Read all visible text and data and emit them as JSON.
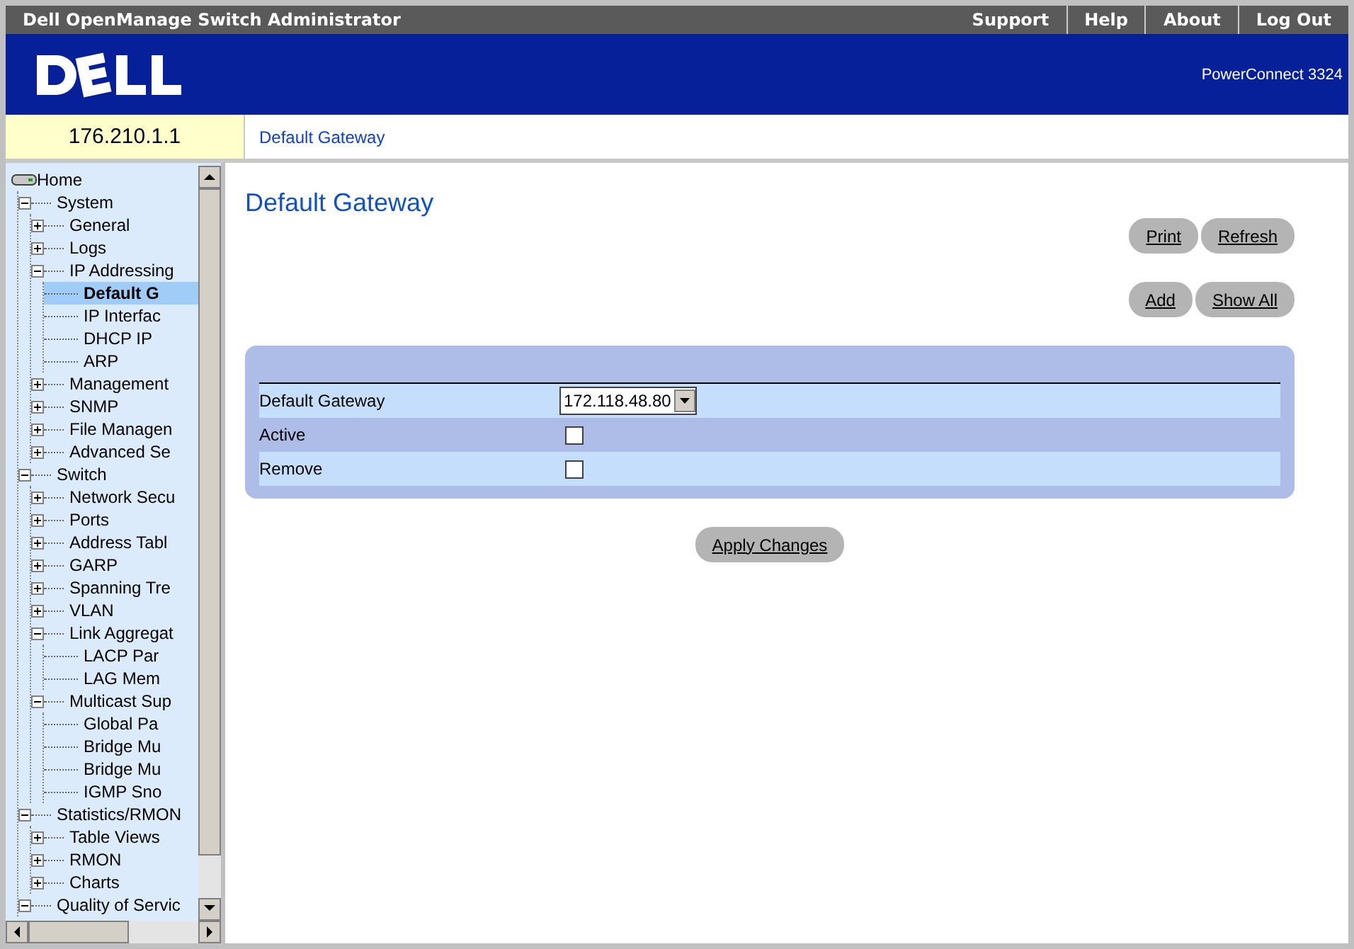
{
  "window": {
    "title": "Dell OpenManage Switch Administrator"
  },
  "top_links": [
    "Support",
    "Help",
    "About",
    "Log Out"
  ],
  "banner": {
    "model": "PowerConnect 3324"
  },
  "device_ip": "176.210.1.1",
  "breadcrumb": "Default Gateway",
  "tree": [
    {
      "label": "Home",
      "kind": "root",
      "children": [
        {
          "label": "System",
          "kind": "folder",
          "expanded": true,
          "children": [
            {
              "label": "General",
              "kind": "folder",
              "expanded": false
            },
            {
              "label": "Logs",
              "kind": "folder",
              "expanded": false
            },
            {
              "label": "IP Addressing",
              "kind": "folder",
              "expanded": true,
              "children": [
                {
                  "label": "Default G",
                  "kind": "leaf",
                  "selected": true
                },
                {
                  "label": "IP Interfac",
                  "kind": "leaf",
                  "selected": false
                },
                {
                  "label": "DHCP IP",
                  "kind": "leaf",
                  "selected": false
                },
                {
                  "label": "ARP",
                  "kind": "leaf",
                  "selected": false
                }
              ]
            },
            {
              "label": "Management",
              "kind": "folder",
              "expanded": false
            },
            {
              "label": "SNMP",
              "kind": "folder",
              "expanded": false
            },
            {
              "label": "File Managen",
              "kind": "folder",
              "expanded": false
            },
            {
              "label": "Advanced Se",
              "kind": "folder",
              "expanded": false
            }
          ]
        },
        {
          "label": "Switch",
          "kind": "folder",
          "expanded": true,
          "children": [
            {
              "label": "Network Secu",
              "kind": "folder",
              "expanded": false
            },
            {
              "label": "Ports",
              "kind": "folder",
              "expanded": false
            },
            {
              "label": "Address Tabl",
              "kind": "folder",
              "expanded": false
            },
            {
              "label": "GARP",
              "kind": "folder",
              "expanded": false
            },
            {
              "label": "Spanning Tre",
              "kind": "folder",
              "expanded": false
            },
            {
              "label": "VLAN",
              "kind": "folder",
              "expanded": false
            },
            {
              "label": "Link Aggregat",
              "kind": "folder",
              "expanded": true,
              "children": [
                {
                  "label": "LACP Par",
                  "kind": "leaf",
                  "selected": false
                },
                {
                  "label": "LAG Mem",
                  "kind": "leaf",
                  "selected": false
                }
              ]
            },
            {
              "label": "Multicast Sup",
              "kind": "folder",
              "expanded": true,
              "children": [
                {
                  "label": "Global Pa",
                  "kind": "leaf",
                  "selected": false
                },
                {
                  "label": "Bridge Mu",
                  "kind": "leaf",
                  "selected": false
                },
                {
                  "label": "Bridge Mu",
                  "kind": "leaf",
                  "selected": false
                },
                {
                  "label": "IGMP Sno",
                  "kind": "leaf",
                  "selected": false
                }
              ]
            }
          ]
        },
        {
          "label": "Statistics/RMON",
          "kind": "folder",
          "expanded": true,
          "children": [
            {
              "label": "Table Views",
              "kind": "folder",
              "expanded": false
            },
            {
              "label": "RMON",
              "kind": "folder",
              "expanded": false
            },
            {
              "label": "Charts",
              "kind": "folder",
              "expanded": false
            }
          ]
        },
        {
          "label": "Quality of Servic",
          "kind": "folder",
          "expanded": true
        }
      ]
    }
  ],
  "page_title": "Default Gateway",
  "button_rows": [
    [
      "Print",
      "Refresh"
    ],
    [
      "Add",
      "Show All"
    ]
  ],
  "form": {
    "rows": [
      {
        "label": "Default Gateway",
        "kind": "select",
        "value": "172.118.48.80"
      },
      {
        "label": "Active",
        "kind": "checkbox",
        "checked": false
      },
      {
        "label": "Remove",
        "kind": "checkbox",
        "checked": false
      }
    ]
  },
  "apply_button": "Apply Changes"
}
